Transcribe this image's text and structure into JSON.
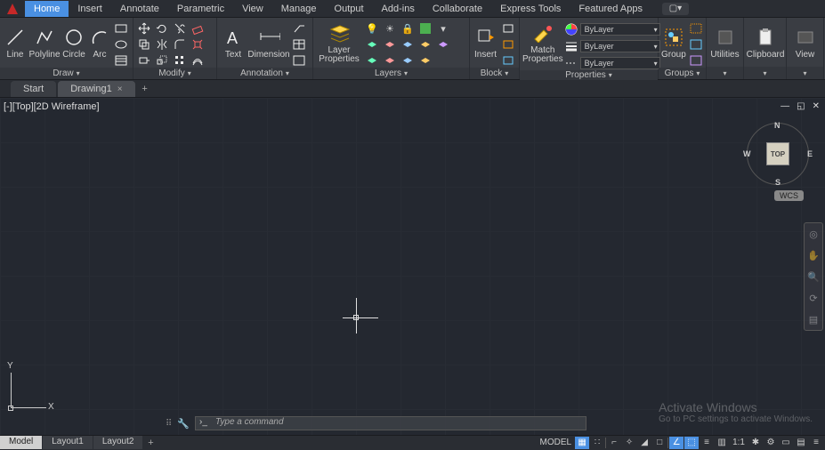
{
  "ribbon": {
    "tabs": [
      "Home",
      "Insert",
      "Annotate",
      "Parametric",
      "View",
      "Manage",
      "Output",
      "Add-ins",
      "Collaborate",
      "Express Tools",
      "Featured Apps"
    ],
    "active_tab": "Home"
  },
  "panels": {
    "draw": {
      "title": "Draw",
      "line": "Line",
      "polyline": "Polyline",
      "circle": "Circle",
      "arc": "Arc"
    },
    "modify": {
      "title": "Modify"
    },
    "annotation": {
      "title": "Annotation",
      "text": "Text",
      "dimension": "Dimension"
    },
    "layers": {
      "title": "Layers",
      "btn": "Layer\nProperties"
    },
    "block": {
      "title": "Block",
      "insert": "Insert"
    },
    "properties": {
      "title": "Properties",
      "match": "Match\nProperties",
      "bylayer1": "ByLayer",
      "bylayer2": "ByLayer",
      "bylayer3": "ByLayer"
    },
    "groups": {
      "title": "Groups",
      "group": "Group"
    },
    "utilities": {
      "title": "Utilities"
    },
    "clipboard": {
      "title": "Clipboard"
    },
    "view": {
      "title": "View",
      "btn": "View"
    }
  },
  "file_tabs": {
    "start": "Start",
    "drawing": "Drawing1"
  },
  "viewport": {
    "label": "[-][Top][2D Wireframe]",
    "cube_face": "TOP",
    "wcs": "WCS",
    "compass": {
      "n": "N",
      "s": "S",
      "e": "E",
      "w": "W"
    },
    "ucs": {
      "x": "X",
      "y": "Y"
    }
  },
  "command": {
    "placeholder": "Type a command"
  },
  "watermark": {
    "title": "Activate Windows",
    "sub": "Go to PC settings to activate Windows."
  },
  "layout_tabs": [
    "Model",
    "Layout1",
    "Layout2"
  ],
  "status": {
    "model": "MODEL",
    "scale": "1:1"
  }
}
